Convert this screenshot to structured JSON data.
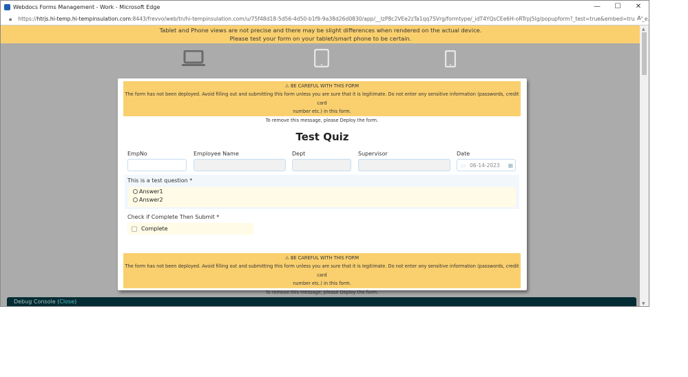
{
  "window": {
    "title": "Webdocs Forms Management - Work - Microsoft Edge",
    "minimize": "—",
    "maximize": "☐",
    "close": "✕"
  },
  "address": {
    "scheme": "https://",
    "host": "htrjs.hi-temp.hi-tempinsulation.com",
    "rest": ":8443/frevvo/web/tn/hi-tempinsulation.com/u/75f48d18-5d56-4d50-b1f9-9a38d26d0830/app/__IzP8c2VEe2zTa1qq7SVrg/formtype/_idT4YQsCEe6H-oRTrpj5lg/popupform?_test=true&embed=true&_e...",
    "read_aloud": "Aᴬ"
  },
  "banner": {
    "line1": "Tablet and Phone views are not precise and there may be slight differences when rendered on the actual device.",
    "line2": "Please test your form on your tablet/smart phone to be certain."
  },
  "warning": {
    "title": "BE CAREFUL WITH THIS FORM",
    "line1": "The form has not been deployed. Avoid filling out and submitting this form unless you are sure that it is legitimate. Do not enter any sensitive information (passwords, credit card",
    "line2": "number etc.) in this form.",
    "line3": "To remove this message, please Deploy the form."
  },
  "form": {
    "title": "Test Quiz",
    "fields": {
      "empno": "EmpNo",
      "name": "Employee Name",
      "dept": "Dept",
      "supervisor": "Supervisor",
      "date": "Date",
      "date_value": "06-14-2023"
    },
    "question": {
      "label": "This is a test question *",
      "options": [
        "Answer1",
        "Answer2"
      ]
    },
    "check": {
      "label": "Check if Complete Then Submit *",
      "option": "Complete"
    }
  },
  "debug": {
    "label": "Debug Console (",
    "close": "Close",
    "end": ")"
  }
}
